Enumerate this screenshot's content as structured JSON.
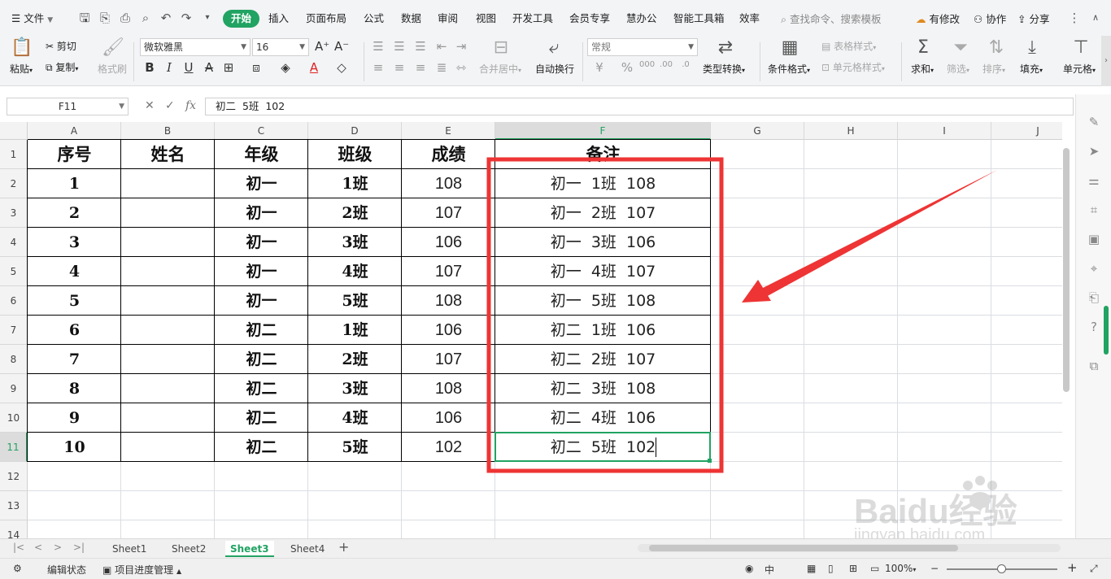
{
  "menubar": {
    "file_label": "文件",
    "tabs": [
      "开始",
      "插入",
      "页面布局",
      "公式",
      "数据",
      "审阅",
      "视图",
      "开发工具",
      "会员专享",
      "慧办公",
      "智能工具箱",
      "效率"
    ],
    "search_placeholder": "查找命令、搜索模板",
    "right_actions": [
      "有修改",
      "协作",
      "分享"
    ]
  },
  "ribbon": {
    "paste": "粘贴",
    "cut": "剪切",
    "copy": "复制",
    "format_painter": "格式刷",
    "font_name": "微软雅黑",
    "font_size": "16",
    "merge_center": "合并居中",
    "wrap_text": "自动换行",
    "number_format": "常规",
    "type_convert": "类型转换",
    "conditional_format": "条件格式",
    "table_style": "表格样式",
    "cell_style": "单元格样式",
    "sum": "求和",
    "filter": "筛选",
    "sort": "排序",
    "fill": "填充",
    "cell": "单元格"
  },
  "formula_bar": {
    "cell_ref": "F11",
    "content": "初二  5班  102"
  },
  "grid": {
    "columns": [
      "A",
      "B",
      "C",
      "D",
      "E",
      "F",
      "G",
      "H",
      "I",
      "J"
    ],
    "selected_column": "F",
    "rows": [
      "1",
      "2",
      "3",
      "4",
      "5",
      "6",
      "7",
      "8",
      "9",
      "10",
      "11",
      "12",
      "13",
      "14"
    ],
    "selected_row": "11",
    "headers": [
      "序号",
      "姓名",
      "年级",
      "班级",
      "成绩",
      "备注"
    ],
    "data": [
      {
        "no": "1",
        "name": "",
        "grade": "初一",
        "cls": "1班",
        "score": "108",
        "note": "初一  1班  108"
      },
      {
        "no": "2",
        "name": "",
        "grade": "初一",
        "cls": "2班",
        "score": "107",
        "note": "初一  2班  107"
      },
      {
        "no": "3",
        "name": "",
        "grade": "初一",
        "cls": "3班",
        "score": "106",
        "note": "初一  3班  106"
      },
      {
        "no": "4",
        "name": "",
        "grade": "初一",
        "cls": "4班",
        "score": "107",
        "note": "初一  4班  107"
      },
      {
        "no": "5",
        "name": "",
        "grade": "初一",
        "cls": "5班",
        "score": "108",
        "note": "初一  5班  108"
      },
      {
        "no": "6",
        "name": "",
        "grade": "初二",
        "cls": "1班",
        "score": "106",
        "note": "初二  1班  106"
      },
      {
        "no": "7",
        "name": "",
        "grade": "初二",
        "cls": "2班",
        "score": "107",
        "note": "初二  2班  107"
      },
      {
        "no": "8",
        "name": "",
        "grade": "初二",
        "cls": "3班",
        "score": "108",
        "note": "初二  3班  108"
      },
      {
        "no": "9",
        "name": "",
        "grade": "初二",
        "cls": "4班",
        "score": "106",
        "note": "初二  4班  106"
      },
      {
        "no": "10",
        "name": "",
        "grade": "初二",
        "cls": "5班",
        "score": "102",
        "note": "初二  5班  102"
      }
    ]
  },
  "annotation": {
    "highlight_color": "#ee3434",
    "arrow_color": "#ee3434"
  },
  "sheets": {
    "tabs": [
      "Sheet1",
      "Sheet2",
      "Sheet3",
      "Sheet4"
    ],
    "active": "Sheet3"
  },
  "statusbar": {
    "edit_state": "编辑状态",
    "project": "项目进度管理",
    "zoom": "100%"
  },
  "watermark": {
    "brand": "Baidu经验",
    "url": "jingyan.baidu.com"
  },
  "colors": {
    "accent": "#21a362",
    "grid_line": "#dadde2"
  }
}
